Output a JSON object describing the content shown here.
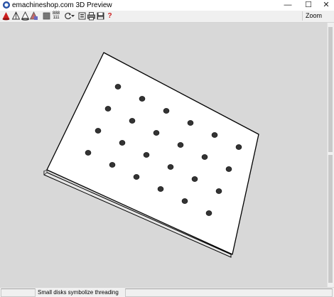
{
  "window": {
    "title": "emachineshop.com 3D Preview",
    "minimize": "—",
    "maximize": "☐",
    "close": "✕"
  },
  "toolbar": {
    "icons": [
      "red-cone-icon",
      "wireframe-cone-icon",
      "outline-cone-icon",
      "color-cone-icon",
      "solid-square-icon",
      "grid-numbers-icon",
      "rotate-icon",
      "dropdown-arrow-icon",
      "info-icon",
      "print-icon",
      "save-icon",
      "help-icon"
    ],
    "grid_label_top": "888",
    "grid_label_bottom": "111",
    "help_label": "?",
    "zoom_label": "Zoom"
  },
  "statusbar": {
    "message": "Small disks symbolize threading"
  },
  "colors": {
    "background": "#d8d8d8",
    "plate_face": "#ffffff",
    "plate_edge": "#000000",
    "hole": "#333333",
    "accent_red": "#cc1f1f"
  }
}
